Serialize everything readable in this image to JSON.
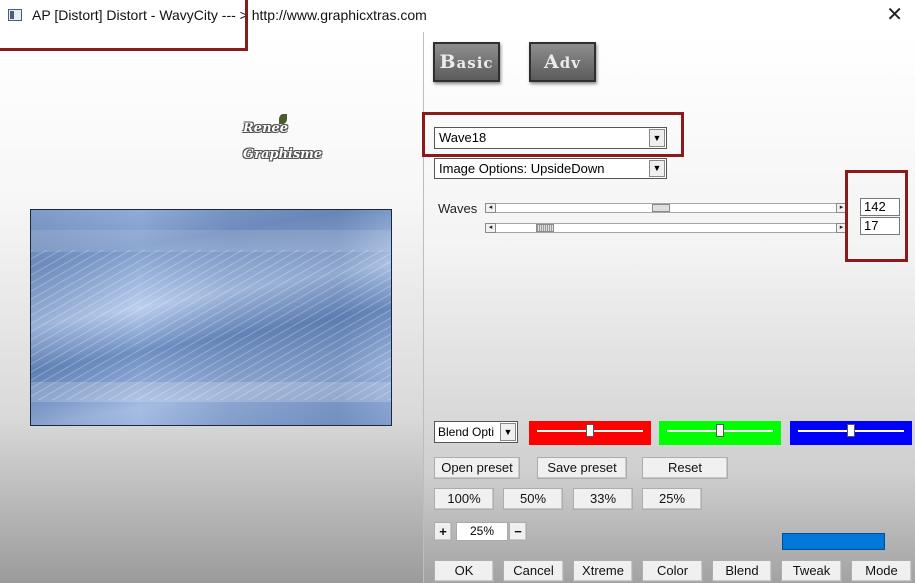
{
  "window": {
    "title": "AP [Distort]  Distort - WavyCity      --- > http://www.graphicxtras.com",
    "close_glyph": "✕"
  },
  "watermark": {
    "line1": "Renee",
    "line2": "Graphisme"
  },
  "tabs": {
    "basic": "Basic",
    "adv": "Adv"
  },
  "effect_select": {
    "value": "Wave18"
  },
  "image_options_select": {
    "value": "Image Options: UpsideDown"
  },
  "sliders": {
    "label": "Waves",
    "waves_1": {
      "value": "142",
      "position": 0.48
    },
    "waves_2": {
      "value": "17",
      "position": 0.12
    }
  },
  "blend": {
    "select_value": "Blend Opti",
    "red": {
      "color": "#ff0000",
      "level": 0.5
    },
    "green": {
      "color": "#00ff00",
      "level": 0.5
    },
    "blue": {
      "color": "#0000ff",
      "level": 0.5
    }
  },
  "preset_buttons": {
    "open": "Open preset",
    "save": "Save preset",
    "reset": "Reset"
  },
  "zoom_buttons": [
    "100%",
    "50%",
    "33%",
    "25%"
  ],
  "zoom_stepper": {
    "plus": "+",
    "value": "25%",
    "minus": "−"
  },
  "swatch_color": "#0078d7",
  "bottom_buttons": [
    "OK",
    "Cancel",
    "Xtreme",
    "Color",
    "Blend",
    "Tweak",
    "Mode"
  ]
}
